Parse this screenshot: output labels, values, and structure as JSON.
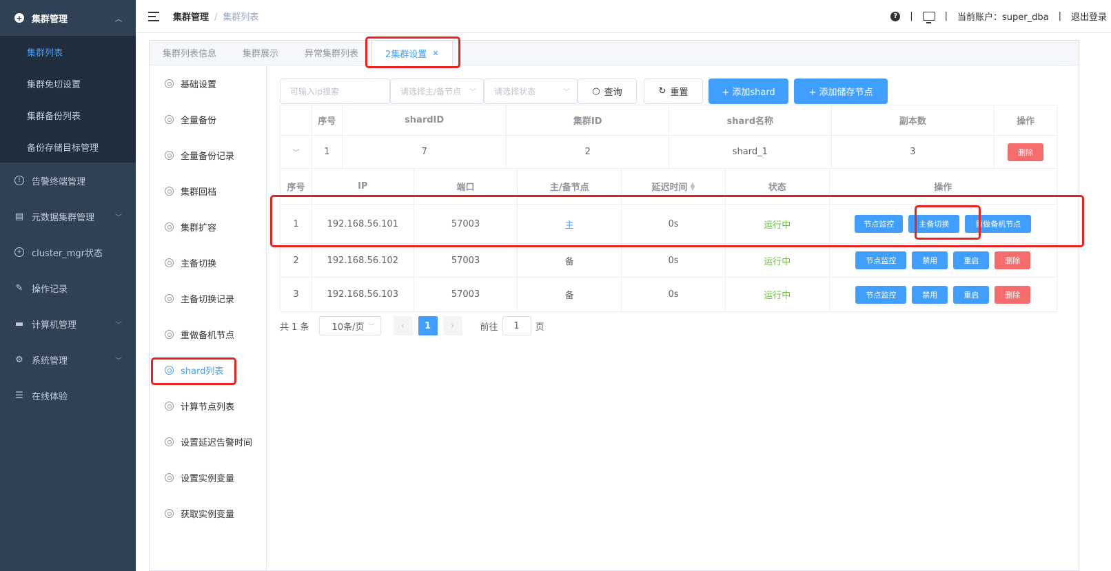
{
  "sidebar": {
    "items": [
      {
        "label": "集群管理",
        "icon": "plus-circle-icon",
        "expanded": true,
        "children": [
          {
            "label": "集群列表",
            "active": true
          },
          {
            "label": "集群免切设置"
          },
          {
            "label": "集群备份列表"
          },
          {
            "label": "备份存储目标管理"
          }
        ]
      },
      {
        "label": "告警终端管理",
        "icon": "alert-circle-icon"
      },
      {
        "label": "元数据集群管理",
        "icon": "database-cluster-icon"
      },
      {
        "label": "cluster_mgr状态",
        "icon": "status-icon"
      },
      {
        "label": "操作记录",
        "icon": "record-icon"
      },
      {
        "label": "计算机管理",
        "icon": "computer-icon"
      },
      {
        "label": "系统管理",
        "icon": "gear-icon"
      },
      {
        "label": "在线体验",
        "icon": "database-icon"
      }
    ]
  },
  "header": {
    "breadcrumb": [
      "集群管理",
      "集群列表"
    ],
    "account_label": "当前账户：super_dba",
    "logout": "退出登录",
    "separator": "|"
  },
  "tabs": [
    {
      "label": "集群列表信息"
    },
    {
      "label": "集群展示"
    },
    {
      "label": "异常集群列表"
    },
    {
      "label": "2集群设置",
      "active": true,
      "closable": true
    }
  ],
  "left_menu": [
    "基础设置",
    "全量备份",
    "全量备份记录",
    "集群回档",
    "集群扩容",
    "主备切换",
    "主备切换记录",
    "重做备机节点",
    "shard列表",
    "计算节点列表",
    "设置延迟告警时间",
    "设置实例变量",
    "获取实例变量"
  ],
  "left_menu_active": "shard列表",
  "toolbar": {
    "ip_placeholder": "可输入ip搜索",
    "role_placeholder": "请选择主/备节点",
    "status_placeholder": "请选择状态",
    "query": "查询",
    "reset": "重置",
    "add_shard": "+ 添加shard",
    "add_storage": "+ 添加储存节点"
  },
  "shard_table": {
    "headers": [
      "序号",
      "shardID",
      "集群ID",
      "shard名称",
      "副本数",
      "操作"
    ],
    "rows": [
      {
        "index": "1",
        "shard_id": "7",
        "cluster_id": "2",
        "name": "shard_1",
        "replicas": "3",
        "action": "删除"
      }
    ]
  },
  "node_table": {
    "headers": [
      "序号",
      "IP",
      "端口",
      "主/备节点",
      "延迟时间",
      "状态",
      "操作"
    ],
    "rows": [
      {
        "index": "1",
        "ip": "192.168.56.101",
        "port": "57003",
        "role": "主",
        "delay": "0s",
        "status": "运行中",
        "actions": [
          "节点监控",
          "主备切换",
          "重做备机节点"
        ]
      },
      {
        "index": "2",
        "ip": "192.168.56.102",
        "port": "57003",
        "role": "备",
        "delay": "0s",
        "status": "运行中",
        "actions": [
          "节点监控",
          "禁用",
          "重启",
          "删除"
        ]
      },
      {
        "index": "3",
        "ip": "192.168.56.103",
        "port": "57003",
        "role": "备",
        "delay": "0s",
        "status": "运行中",
        "actions": [
          "节点监控",
          "禁用",
          "重启",
          "删除"
        ]
      }
    ]
  },
  "pagination": {
    "total": "共 1 条",
    "page_size": "10条/页",
    "current_page": "1",
    "goto_label": "前往",
    "goto_value": "1",
    "page_suffix": "页"
  },
  "colors": {
    "sidebar_bg": "#304156",
    "primary": "#409eff",
    "danger": "#f56c6c",
    "success": "#67c23a",
    "highlight": "#e8231f"
  }
}
